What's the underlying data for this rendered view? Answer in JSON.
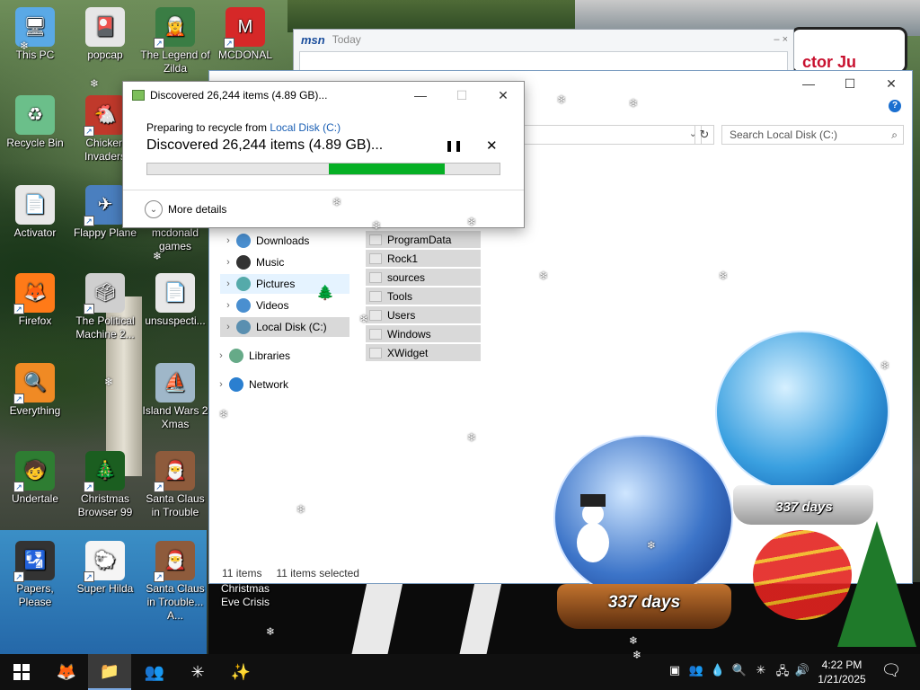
{
  "desktop": {
    "icons": [
      {
        "label": "This PC",
        "glyph": "🖥",
        "icon": "this-pc-icon",
        "shortcut": false
      },
      {
        "label": "popcap",
        "glyph": "🎴",
        "icon": "popcap-icon",
        "shortcut": false
      },
      {
        "label": "The Legend of Zilda",
        "glyph": "🧝",
        "icon": "zilda-icon",
        "shortcut": true
      },
      {
        "label": "MCDONAL",
        "glyph": "M",
        "icon": "mcdonalds-icon",
        "shortcut": true
      },
      {
        "label": "Recycle Bin",
        "glyph": "♻",
        "icon": "recycle-bin-icon",
        "shortcut": false
      },
      {
        "label": "Chicken Invaders",
        "glyph": "🐔",
        "icon": "chicken-invaders-icon",
        "shortcut": true
      },
      {
        "label": "Activator",
        "glyph": "📄",
        "icon": "activator-icon",
        "shortcut": false
      },
      {
        "label": "Flappy Plane",
        "glyph": "✈",
        "icon": "flappy-plane-icon",
        "shortcut": true
      },
      {
        "label": "mcdonald games",
        "glyph": "",
        "icon": "mcdonald-games-icon",
        "shortcut": false
      },
      {
        "label": "Firefox",
        "glyph": "🦊",
        "icon": "firefox-icon",
        "shortcut": true
      },
      {
        "label": "The Political Machine 2...",
        "glyph": "🗳",
        "icon": "political-machine-icon",
        "shortcut": true
      },
      {
        "label": "unsuspecti...",
        "glyph": "📄",
        "icon": "unsuspecting-icon",
        "shortcut": false
      },
      {
        "label": "Everything",
        "glyph": "🔍",
        "icon": "everything-icon",
        "shortcut": true
      },
      {
        "label": "Island Wars 2 Xmas",
        "glyph": "⛵",
        "icon": "island-wars-icon",
        "shortcut": false
      },
      {
        "label": "Undertale",
        "glyph": "🧒",
        "icon": "undertale-icon",
        "shortcut": true
      },
      {
        "label": "Christmas Browser 99",
        "glyph": "🎄",
        "icon": "christmas-browser-icon",
        "shortcut": true
      },
      {
        "label": "Santa Claus in Trouble",
        "glyph": "🎅",
        "icon": "santa-claus-icon",
        "shortcut": true
      },
      {
        "label": "Papers, Please",
        "glyph": "🛂",
        "icon": "papers-please-icon",
        "shortcut": true
      },
      {
        "label": "Super Hilda",
        "glyph": "🐑",
        "icon": "super-hilda-icon",
        "shortcut": true
      },
      {
        "label": "Santa Claus in Trouble... A...",
        "glyph": "🎅",
        "icon": "santa-claus-2-icon",
        "shortcut": true
      },
      {
        "label": "Christmas Eve Crisis",
        "glyph": "",
        "icon": "christmas-eve-crisis-icon",
        "shortcut": false
      }
    ]
  },
  "msn": {
    "logo": "msn",
    "title": "Today",
    "controls": "– ×"
  },
  "explorer": {
    "search_placeholder": "Search Local Disk (C:)",
    "nav": [
      {
        "label": "Downloads",
        "state": ""
      },
      {
        "label": "Music",
        "state": ""
      },
      {
        "label": "Pictures",
        "state": "hover"
      },
      {
        "label": "Videos",
        "state": ""
      },
      {
        "label": "Local Disk (C:)",
        "state": "current"
      },
      {
        "label": "Libraries",
        "state": ""
      },
      {
        "label": "Network",
        "state": ""
      }
    ],
    "files": [
      "ProgramData",
      "Rock1",
      "sources",
      "Tools",
      "Users",
      "Windows",
      "XWidget"
    ],
    "status_count": "11 items",
    "status_selected": "11 items selected"
  },
  "dialog": {
    "title": "Discovered 26,244 items (4.89 GB)...",
    "line1_prefix": "Preparing to recycle from ",
    "line1_link": "Local Disk (C:)",
    "line2": "Discovered 26,244 items (4.89 GB)...",
    "progress": 0.33,
    "more_details": "More details",
    "pause_glyph": "❚❚",
    "cancel_glyph": "✕"
  },
  "globes": {
    "left_label": "337 days",
    "right_label": "337 days"
  },
  "taskbar": {
    "time": "4:22 PM",
    "date": "1/21/2025",
    "accent": "#7aa7e0"
  }
}
